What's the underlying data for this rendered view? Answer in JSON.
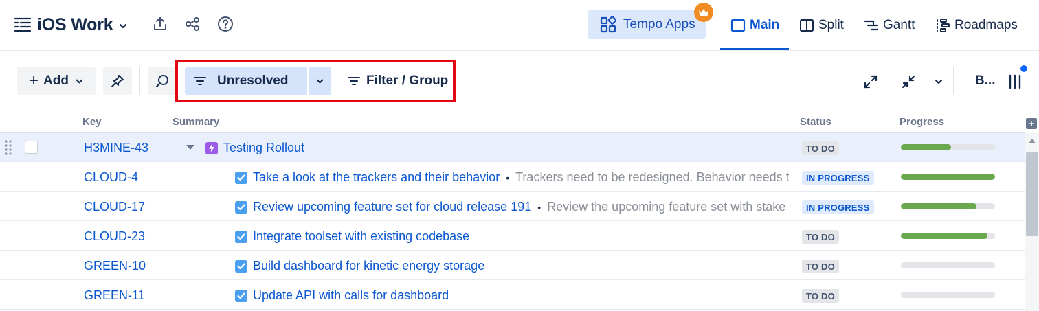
{
  "header": {
    "title": "iOS Work",
    "tempo_label": "Tempo Apps",
    "tabs": [
      {
        "label": "Main",
        "active": true,
        "icon": "main-view-icon"
      },
      {
        "label": "Split",
        "active": false,
        "icon": "split-view-icon"
      },
      {
        "label": "Gantt",
        "active": false,
        "icon": "gantt-icon"
      },
      {
        "label": "Roadmaps",
        "active": false,
        "icon": "roadmaps-icon"
      }
    ]
  },
  "toolbar": {
    "add_label": "Add",
    "filter_label": "Unresolved",
    "filter_group_label": "Filter / Group",
    "b_label": "B..."
  },
  "table": {
    "columns": {
      "key": "Key",
      "summary": "Summary",
      "status": "Status",
      "progress": "Progress"
    },
    "rows": [
      {
        "key": "H3MINE-43",
        "type": "epic",
        "title": "Testing Rollout",
        "desc": "",
        "status": "TO DO",
        "progress": 0.53
      },
      {
        "key": "CLOUD-4",
        "type": "task",
        "title": "Take a look at the trackers and their behavior",
        "desc": "Trackers need to be redesigned. Behavior needs t",
        "status": "IN PROGRESS",
        "progress": 1.0
      },
      {
        "key": "CLOUD-17",
        "type": "task",
        "title": "Review upcoming feature set for cloud release 191",
        "desc": "Review the upcoming feature set with stake",
        "status": "IN PROGRESS",
        "progress": 0.8
      },
      {
        "key": "CLOUD-23",
        "type": "task",
        "title": "Integrate toolset with existing codebase",
        "desc": "",
        "status": "TO DO",
        "progress": 0.92
      },
      {
        "key": "GREEN-10",
        "type": "task",
        "title": "Build dashboard for kinetic energy storage",
        "desc": "",
        "status": "TO DO",
        "progress": 0.0
      },
      {
        "key": "GREEN-11",
        "type": "task",
        "title": "Update API with calls for dashboard",
        "desc": "",
        "status": "TO DO",
        "progress": 0.0
      }
    ]
  },
  "colors": {
    "accent": "#0b57d0",
    "highlight_box": "#e30613",
    "progress_fill": "#6aa84f",
    "crown": "#f08c22"
  }
}
